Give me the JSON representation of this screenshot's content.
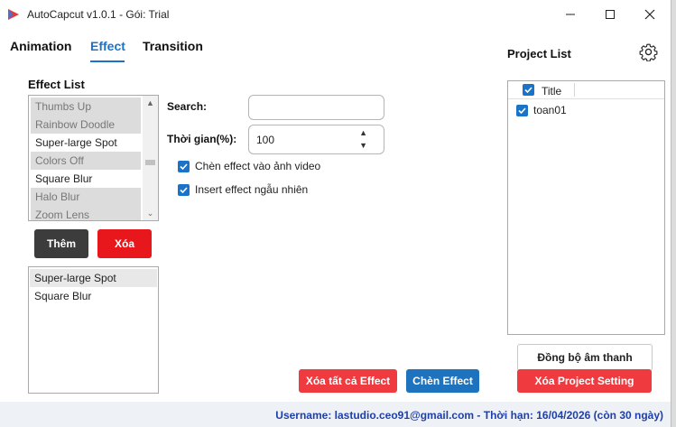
{
  "window": {
    "title": "AutoCapcut v1.0.1 - Gói: Trial"
  },
  "tabs": [
    {
      "label": "Animation",
      "active": false
    },
    {
      "label": "Effect",
      "active": true
    },
    {
      "label": "Transition",
      "active": false
    }
  ],
  "effect_list": {
    "label": "Effect List",
    "items": [
      {
        "label": "Thumbs Up",
        "style": "gray"
      },
      {
        "label": "Rainbow Doodle",
        "style": "gray"
      },
      {
        "label": "Super-large Spot",
        "style": "normal"
      },
      {
        "label": "Colors Off",
        "style": "gray"
      },
      {
        "label": "Square Blur",
        "style": "normal"
      },
      {
        "label": "Halo Blur",
        "style": "gray"
      },
      {
        "label": "Zoom Lens",
        "style": "gray"
      }
    ]
  },
  "buttons": {
    "add": "Thêm",
    "delete": "Xóa",
    "delete_all_effects": "Xóa tất cả Effect",
    "insert_effect": "Chèn Effect",
    "sync_audio": "Đồng bộ âm thanh",
    "delete_project_setting": "Xóa Project Setting"
  },
  "selected_effects": [
    "Super-large Spot",
    "Square Blur"
  ],
  "search": {
    "label": "Search:",
    "value": ""
  },
  "duration": {
    "label": "Thời gian(%):",
    "value": "100"
  },
  "options": [
    {
      "label": "Chèn effect vào ảnh video",
      "checked": true
    },
    {
      "label": "Insert effect ngẫu nhiên",
      "checked": true
    }
  ],
  "project_list": {
    "label": "Project List",
    "header": "Title",
    "header_checked": true,
    "rows": [
      {
        "title": "toan01",
        "checked": true
      }
    ]
  },
  "status": {
    "text": "Username: lastudio.ceo91@gmail.com - Thời hạn: 16/04/2026 (còn 30 ngày)"
  },
  "icons": {
    "settings": "gear-icon",
    "app": "app-logo-icon"
  },
  "colors": {
    "accent": "#1a73c8",
    "danger": "#e8171c",
    "status_text": "#1f3fa8"
  }
}
